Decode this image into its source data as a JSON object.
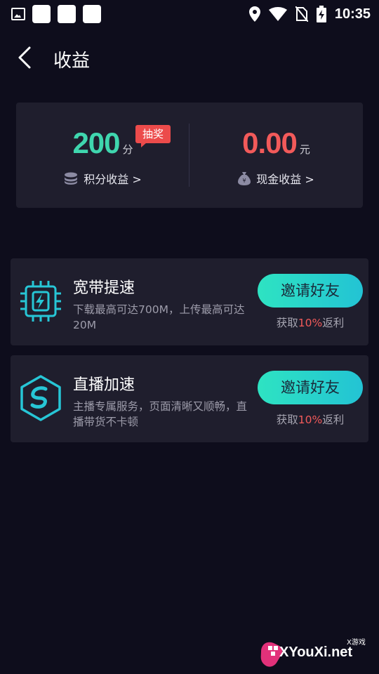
{
  "status_bar": {
    "time": "10:35",
    "icons": [
      "image-icon",
      "app-square-icon",
      "app-square-icon",
      "app-square-icon",
      "location-icon",
      "wifi-icon",
      "no-sim-icon",
      "battery-charging-icon"
    ]
  },
  "header": {
    "title": "收益",
    "back_icon": "chevron-left-icon"
  },
  "earnings": {
    "points": {
      "value": "200",
      "unit": "分",
      "badge": "抽奖",
      "link": "积分收益 >",
      "icon": "coin-stack-icon",
      "color": "#3fd6ae"
    },
    "cash": {
      "value": "0.00",
      "unit": "元",
      "link": "现金收益 >",
      "icon": "money-bag-icon",
      "color": "#f25a5a"
    }
  },
  "features": [
    {
      "title": "宽带提速",
      "desc": "下载最高可达700M，上传最高可达20M",
      "icon": "chip-bolt-icon",
      "button": "邀请好友",
      "rebate_prefix": "获取",
      "rebate_pct": "10%",
      "rebate_suffix": "返利"
    },
    {
      "title": "直播加速",
      "desc": "主播专属服务，页面清晰又顺畅，直播带货不卡顿",
      "icon": "hexagon-s-icon",
      "button": "邀请好友",
      "rebate_prefix": "获取",
      "rebate_pct": "10%",
      "rebate_suffix": "返利"
    }
  ],
  "watermark": {
    "text": "XYouXi.net",
    "small": "X游戏"
  },
  "colors": {
    "background": "#0e0d1c",
    "card": "#1f1e2d",
    "accent": "#2ee3c2",
    "red": "#f25a5a"
  }
}
